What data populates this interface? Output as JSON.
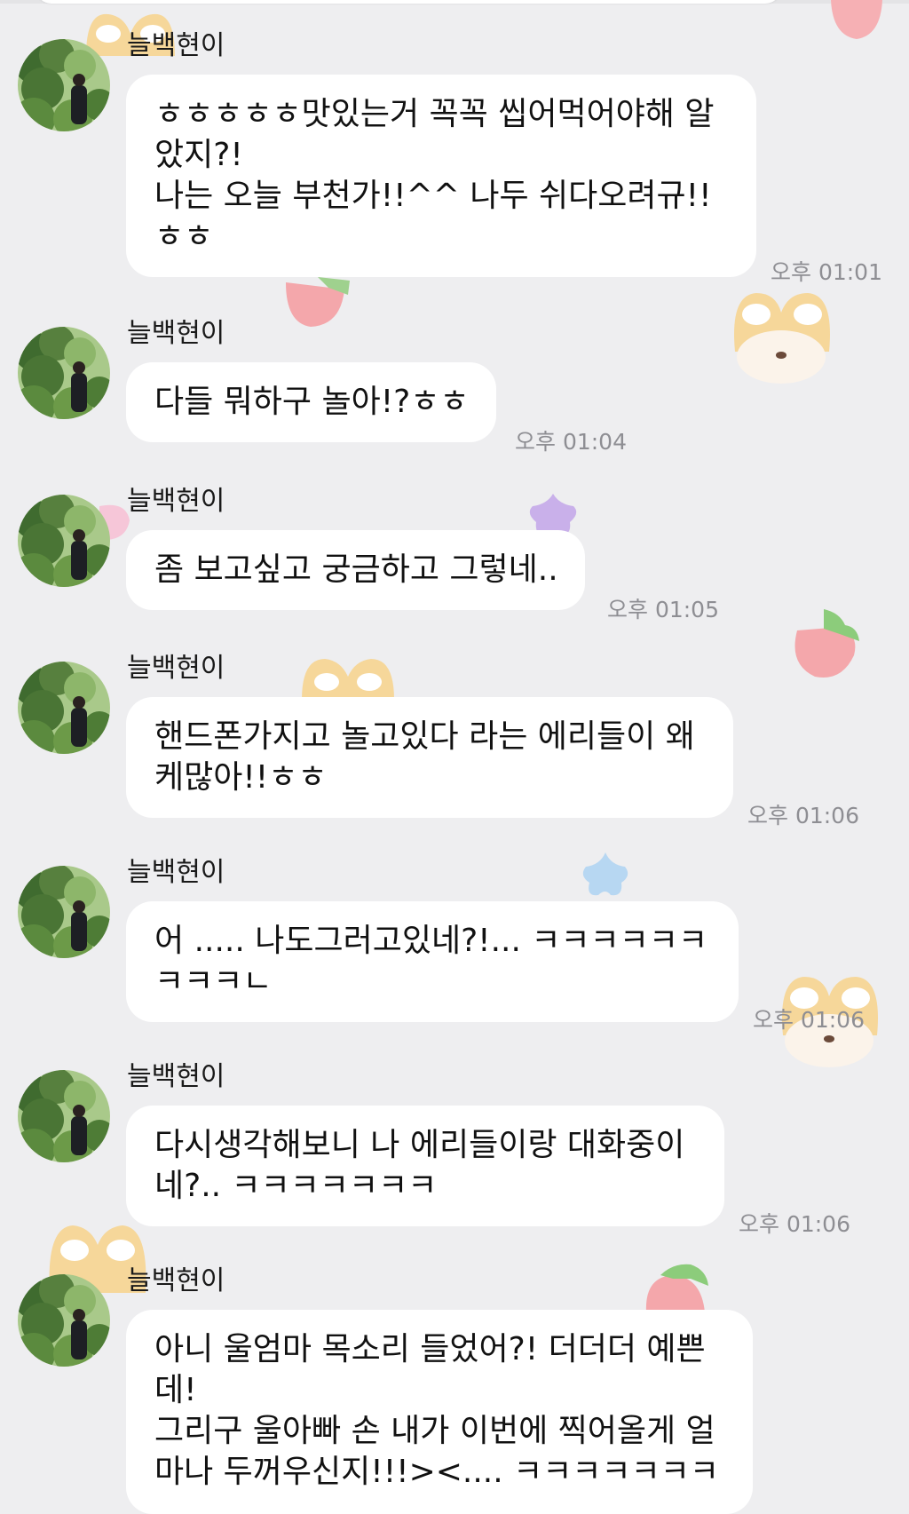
{
  "chat": {
    "messages": [
      {
        "sender": "늘백현이",
        "text": "ㅎㅎㅎㅎㅎ맛있는거 꼭꼭 씹어먹어야해 알았지?!\n나는 오늘 부천가!!^^ 나두 쉬다오려규!!ㅎㅎ",
        "time": "오후 01:01"
      },
      {
        "sender": "늘백현이",
        "text": "다들 뭐하구 놀아!?ㅎㅎ",
        "time": "오후 01:04"
      },
      {
        "sender": "늘백현이",
        "text": "좀 보고싶고 궁금하고 그렇네..",
        "time": "오후 01:05"
      },
      {
        "sender": "늘백현이",
        "text": "핸드폰가지고 놀고있다 라는 에리들이 왜 케많아!!ㅎㅎ",
        "time": "오후 01:06"
      },
      {
        "sender": "늘백현이",
        "text": "어 ..... 나도그러고있네?!... ㅋㅋㅋㅋㅋㅋㅋㅋㅋㄴ",
        "time": "오후 01:06"
      },
      {
        "sender": "늘백현이",
        "text": "다시생각해보니 나 에리들이랑 대화중이네?.. ㅋㅋㅋㅋㅋㅋㅋ",
        "time": "오후 01:06"
      },
      {
        "sender": "늘백현이",
        "text": "아니 울엄마 목소리 들었어?! 더더더 예쁜데!\n그리구 울아빠 손 내가 이번에 찍어올게 얼마나 두꺼우신지!!!><.... ㅋㅋㅋㅋㅋㅋㅋ",
        "time": ""
      }
    ]
  },
  "colors": {
    "background": "#eeeef0",
    "bubble": "#ffffff",
    "time_text": "#8e8e93",
    "sender_text": "#1a1a1a"
  },
  "icons": {
    "avatar": "avatar-photo-garden",
    "decorations": [
      "strawberry-sticker",
      "fox-sticker",
      "star-sticker"
    ]
  }
}
